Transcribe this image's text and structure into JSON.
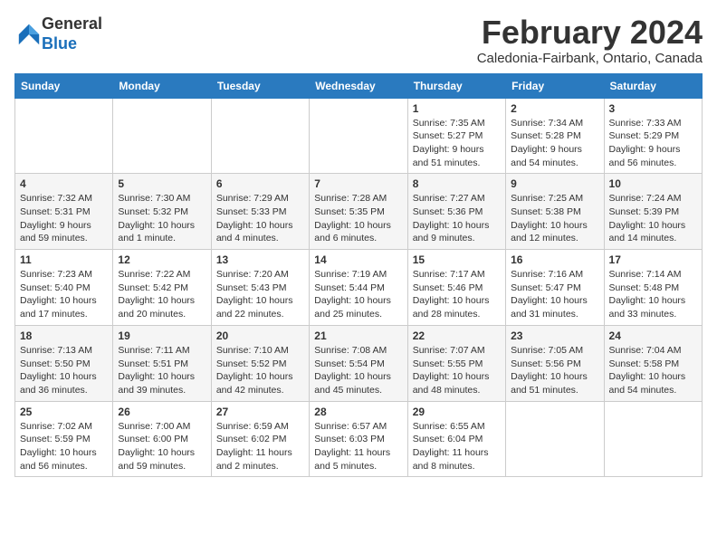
{
  "logo": {
    "general": "General",
    "blue": "Blue"
  },
  "title": "February 2024",
  "location": "Caledonia-Fairbank, Ontario, Canada",
  "days_of_week": [
    "Sunday",
    "Monday",
    "Tuesday",
    "Wednesday",
    "Thursday",
    "Friday",
    "Saturday"
  ],
  "weeks": [
    [
      {
        "day": "",
        "info": ""
      },
      {
        "day": "",
        "info": ""
      },
      {
        "day": "",
        "info": ""
      },
      {
        "day": "",
        "info": ""
      },
      {
        "day": "1",
        "info": "Sunrise: 7:35 AM\nSunset: 5:27 PM\nDaylight: 9 hours and 51 minutes."
      },
      {
        "day": "2",
        "info": "Sunrise: 7:34 AM\nSunset: 5:28 PM\nDaylight: 9 hours and 54 minutes."
      },
      {
        "day": "3",
        "info": "Sunrise: 7:33 AM\nSunset: 5:29 PM\nDaylight: 9 hours and 56 minutes."
      }
    ],
    [
      {
        "day": "4",
        "info": "Sunrise: 7:32 AM\nSunset: 5:31 PM\nDaylight: 9 hours and 59 minutes."
      },
      {
        "day": "5",
        "info": "Sunrise: 7:30 AM\nSunset: 5:32 PM\nDaylight: 10 hours and 1 minute."
      },
      {
        "day": "6",
        "info": "Sunrise: 7:29 AM\nSunset: 5:33 PM\nDaylight: 10 hours and 4 minutes."
      },
      {
        "day": "7",
        "info": "Sunrise: 7:28 AM\nSunset: 5:35 PM\nDaylight: 10 hours and 6 minutes."
      },
      {
        "day": "8",
        "info": "Sunrise: 7:27 AM\nSunset: 5:36 PM\nDaylight: 10 hours and 9 minutes."
      },
      {
        "day": "9",
        "info": "Sunrise: 7:25 AM\nSunset: 5:38 PM\nDaylight: 10 hours and 12 minutes."
      },
      {
        "day": "10",
        "info": "Sunrise: 7:24 AM\nSunset: 5:39 PM\nDaylight: 10 hours and 14 minutes."
      }
    ],
    [
      {
        "day": "11",
        "info": "Sunrise: 7:23 AM\nSunset: 5:40 PM\nDaylight: 10 hours and 17 minutes."
      },
      {
        "day": "12",
        "info": "Sunrise: 7:22 AM\nSunset: 5:42 PM\nDaylight: 10 hours and 20 minutes."
      },
      {
        "day": "13",
        "info": "Sunrise: 7:20 AM\nSunset: 5:43 PM\nDaylight: 10 hours and 22 minutes."
      },
      {
        "day": "14",
        "info": "Sunrise: 7:19 AM\nSunset: 5:44 PM\nDaylight: 10 hours and 25 minutes."
      },
      {
        "day": "15",
        "info": "Sunrise: 7:17 AM\nSunset: 5:46 PM\nDaylight: 10 hours and 28 minutes."
      },
      {
        "day": "16",
        "info": "Sunrise: 7:16 AM\nSunset: 5:47 PM\nDaylight: 10 hours and 31 minutes."
      },
      {
        "day": "17",
        "info": "Sunrise: 7:14 AM\nSunset: 5:48 PM\nDaylight: 10 hours and 33 minutes."
      }
    ],
    [
      {
        "day": "18",
        "info": "Sunrise: 7:13 AM\nSunset: 5:50 PM\nDaylight: 10 hours and 36 minutes."
      },
      {
        "day": "19",
        "info": "Sunrise: 7:11 AM\nSunset: 5:51 PM\nDaylight: 10 hours and 39 minutes."
      },
      {
        "day": "20",
        "info": "Sunrise: 7:10 AM\nSunset: 5:52 PM\nDaylight: 10 hours and 42 minutes."
      },
      {
        "day": "21",
        "info": "Sunrise: 7:08 AM\nSunset: 5:54 PM\nDaylight: 10 hours and 45 minutes."
      },
      {
        "day": "22",
        "info": "Sunrise: 7:07 AM\nSunset: 5:55 PM\nDaylight: 10 hours and 48 minutes."
      },
      {
        "day": "23",
        "info": "Sunrise: 7:05 AM\nSunset: 5:56 PM\nDaylight: 10 hours and 51 minutes."
      },
      {
        "day": "24",
        "info": "Sunrise: 7:04 AM\nSunset: 5:58 PM\nDaylight: 10 hours and 54 minutes."
      }
    ],
    [
      {
        "day": "25",
        "info": "Sunrise: 7:02 AM\nSunset: 5:59 PM\nDaylight: 10 hours and 56 minutes."
      },
      {
        "day": "26",
        "info": "Sunrise: 7:00 AM\nSunset: 6:00 PM\nDaylight: 10 hours and 59 minutes."
      },
      {
        "day": "27",
        "info": "Sunrise: 6:59 AM\nSunset: 6:02 PM\nDaylight: 11 hours and 2 minutes."
      },
      {
        "day": "28",
        "info": "Sunrise: 6:57 AM\nSunset: 6:03 PM\nDaylight: 11 hours and 5 minutes."
      },
      {
        "day": "29",
        "info": "Sunrise: 6:55 AM\nSunset: 6:04 PM\nDaylight: 11 hours and 8 minutes."
      },
      {
        "day": "",
        "info": ""
      },
      {
        "day": "",
        "info": ""
      }
    ]
  ]
}
